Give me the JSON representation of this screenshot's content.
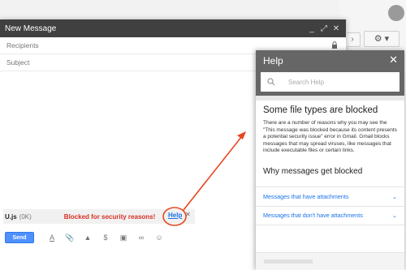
{
  "compose": {
    "title": "New Message",
    "recipients_placeholder": "Recipients",
    "subject_placeholder": "Subject",
    "attachment": {
      "filename": "U.js",
      "size": "(0K)",
      "blocked_text": "Blocked for security reasons!",
      "help_link": "Help"
    },
    "send_label": "Send"
  },
  "help": {
    "title": "Help",
    "search_placeholder": "Search Help",
    "heading": "Some file types are blocked",
    "body": "There are a number of reasons why you may see the \"This message was blocked because its content presents a potential security issue\" error in Gmail. Gmail blocks messages that may spread viruses, like messages that include executable files or certain links.",
    "subheading": "Why messages get blocked",
    "items": [
      {
        "label": "Messages that have attachments"
      },
      {
        "label": "Messages that don't have attachments"
      }
    ]
  },
  "colors": {
    "accent": "#1a73e8",
    "blocked": "#d93025",
    "annotation": "#e8461f",
    "send": "#4d90fe"
  },
  "icons": [
    "minimize-icon",
    "expand-icon",
    "close-icon",
    "lock-icon",
    "format-text-icon",
    "attach-icon",
    "drive-icon",
    "money-icon",
    "photo-icon",
    "link-icon",
    "emoji-icon",
    "search-icon",
    "chevron-down-icon",
    "gear-icon"
  ]
}
